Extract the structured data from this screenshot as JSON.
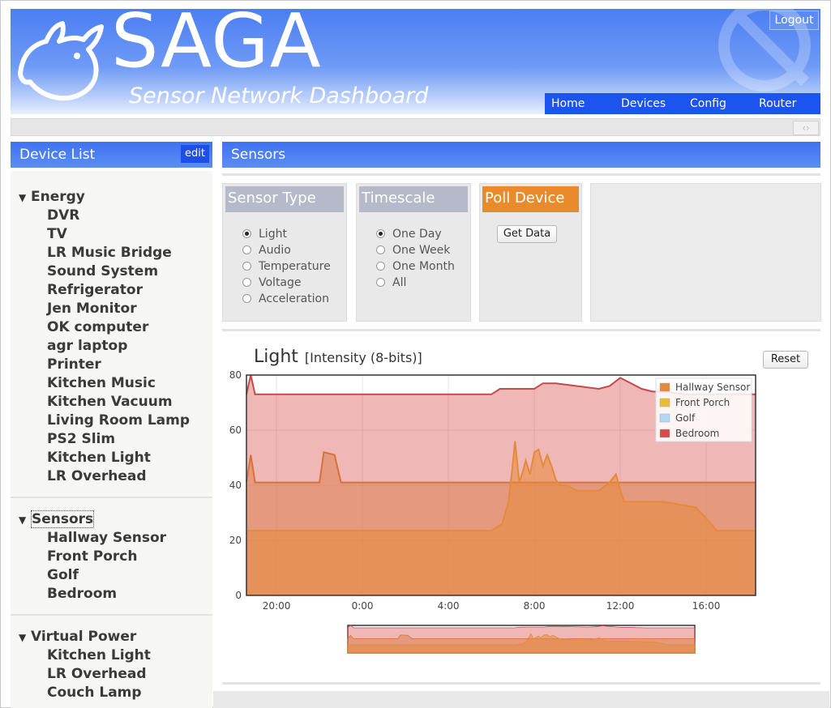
{
  "app": {
    "title": "SAGA",
    "subtitle": "Sensor Network Dashboard",
    "logout_label": "Logout"
  },
  "nav": {
    "items": [
      "Home",
      "Devices",
      "Config",
      "Router"
    ]
  },
  "strip": {
    "arrows_icon": "expand-arrows-icon"
  },
  "sidebar": {
    "title": "Device List",
    "edit_label": "edit",
    "groups": [
      {
        "title": "Energy",
        "items": [
          "DVR",
          "TV",
          "LR Music Bridge",
          "Sound System",
          "Refrigerator",
          "Jen Monitor",
          "OK computer",
          "agr laptop",
          "Printer",
          "Kitchen Music",
          "Kitchen Vacuum",
          "Living Room Lamp",
          "PS2 Slim",
          "Kitchen Light",
          "LR Overhead"
        ]
      },
      {
        "title": "Sensors",
        "items": [
          "Hallway Sensor",
          "Front Porch",
          "Golf",
          "Bedroom"
        ]
      },
      {
        "title": "Virtual Power",
        "items": [
          "Kitchen Light",
          "LR Overhead",
          "Couch Lamp"
        ]
      }
    ]
  },
  "main": {
    "title": "Sensors",
    "sensor_type": {
      "title": "Sensor Type",
      "options": [
        "Light",
        "Audio",
        "Temperature",
        "Voltage",
        "Acceleration"
      ],
      "selected": "Light"
    },
    "timescale": {
      "title": "Timescale",
      "options": [
        "One Day",
        "One Week",
        "One Month",
        "All"
      ],
      "selected": "One Day"
    },
    "poll": {
      "title": "Poll Device",
      "button_label": "Get Data"
    },
    "reset_label": "Reset"
  },
  "colors": {
    "header_blue": "#4b7ef2",
    "nav_blue": "#1d53ee",
    "box_title": "#b4b8c8",
    "poll_orange": "#e98b2b"
  },
  "chart_data": {
    "type": "area",
    "title": "Light",
    "ylabel": "[Intensity (8-bits)]",
    "ylim": [
      0,
      80
    ],
    "yticks": [
      0,
      20,
      40,
      60,
      80
    ],
    "xticks": [
      "20:00",
      "0:00",
      "4:00",
      "8:00",
      "12:00",
      "16:00"
    ],
    "x_hours_range": [
      18.6,
      42.3
    ],
    "legend_position": "top-right",
    "series": [
      {
        "name": "Hallway Sensor",
        "color": "#e58a3a",
        "x": [
          18.6,
          30.0,
          30.5,
          30.8,
          31.0,
          31.1,
          31.3,
          31.5,
          31.6,
          31.8,
          32.0,
          32.2,
          32.4,
          32.6,
          32.8,
          33.0,
          33.2,
          33.5,
          34.0,
          35.0,
          35.5,
          35.8,
          36.0,
          36.2,
          36.5,
          38.0,
          39.5,
          40.0,
          40.5,
          41.5,
          42.3
        ],
        "y": [
          23.5,
          23.5,
          26,
          34,
          48,
          56,
          41,
          46,
          49,
          44,
          52,
          53,
          47,
          51,
          47,
          42,
          40,
          40,
          38,
          38,
          41,
          44,
          38,
          34,
          34,
          34,
          32,
          28,
          23.5,
          23.5,
          23.5
        ]
      },
      {
        "name": "Front Porch",
        "color": "#e8bd3a",
        "x": [
          18.6,
          18.8,
          19.0,
          21.0,
          22.0,
          22.2,
          22.7,
          23.0,
          30.0,
          42.3
        ],
        "y": [
          41,
          51,
          41,
          41,
          41,
          52,
          51,
          41,
          41,
          41
        ]
      },
      {
        "name": "Golf",
        "color": "#b3d7f4",
        "x": [],
        "y": []
      },
      {
        "name": "Bedroom",
        "color": "#d94b4b",
        "x": [
          18.6,
          18.8,
          19.0,
          30.0,
          30.4,
          32.0,
          32.4,
          33.0,
          35.0,
          35.5,
          36.0,
          37.0,
          37.5,
          38.0,
          39.0,
          42.3
        ],
        "y": [
          73,
          80,
          73,
          73,
          75,
          75,
          77,
          77,
          75,
          76,
          79,
          75,
          74,
          74,
          73,
          73
        ]
      }
    ]
  }
}
